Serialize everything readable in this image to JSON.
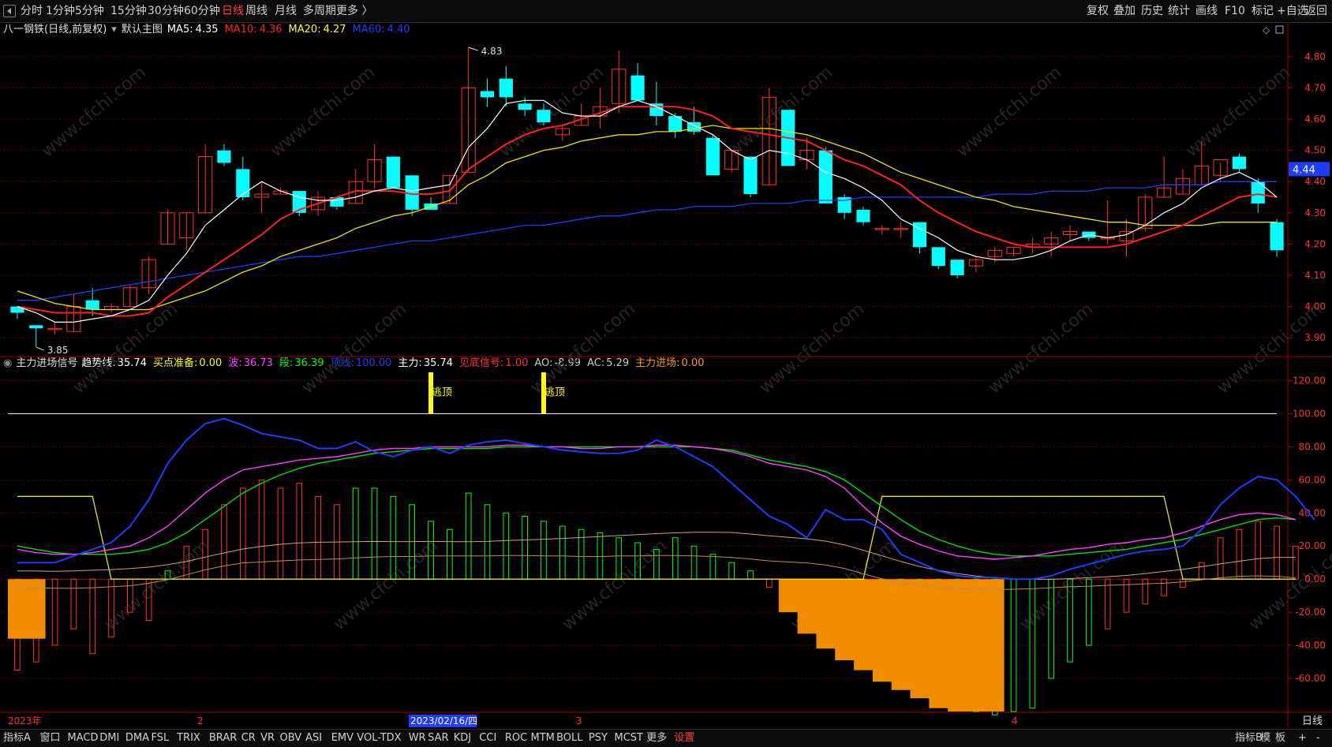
{
  "toolbar": {
    "periods": [
      "分时",
      "1分钟",
      "5分钟",
      "15分钟",
      "30分钟",
      "60分钟",
      "日线",
      "周线",
      "月线",
      "多周期",
      "更多 〉"
    ],
    "active_period": "日线",
    "right_buttons": [
      "复权",
      "叠加",
      "历史",
      "统计",
      "画线",
      "F10",
      "标记",
      "+自选",
      "返回"
    ]
  },
  "main_panel": {
    "stock": "八一钢铁",
    "mode": "(日线,前复权)",
    "template": "默认主图",
    "ma_legend": [
      {
        "label": "MA5:",
        "value": "4.35",
        "color": "#ffffff"
      },
      {
        "label": "MA10:",
        "value": "4.36",
        "color": "#ff2020"
      },
      {
        "label": "MA20:",
        "value": "4.27",
        "color": "#ffff00"
      },
      {
        "label": "MA60:",
        "value": "4.40",
        "color": "#1e3cff"
      }
    ],
    "price_axis": [
      "4.80",
      "4.70",
      "4.60",
      "4.50",
      "4.40",
      "4.30",
      "4.20",
      "4.10",
      "4.00",
      "3.90"
    ],
    "current_price_tag": "4.44",
    "high_label": "4.83",
    "low_label": "3.85"
  },
  "indicator_panel": {
    "name": "主力进场信号",
    "legend": [
      {
        "label": "趋势线:",
        "value": "35.74",
        "color": "#ffffff"
      },
      {
        "label": "买点准备:",
        "value": "0.00",
        "color": "#ffff00"
      },
      {
        "label": "波:",
        "value": "36.73",
        "color": "#ff40ff"
      },
      {
        "label": "段:",
        "value": "36.39",
        "color": "#00ff00"
      },
      {
        "label": "顶线:",
        "value": "100.00",
        "color": "#1e3cff"
      },
      {
        "label": "主力:",
        "value": "35.74",
        "color": "#ffffff"
      },
      {
        "label": "见底信号:",
        "value": "1.00",
        "color": "#ff3030"
      },
      {
        "label": "AO:",
        "value": "-8.99",
        "color": "#c8c8c8"
      },
      {
        "label": "AC:",
        "value": "5.29",
        "color": "#c8c8c8"
      },
      {
        "label": "主力进场:",
        "value": "0.00",
        "color": "#ff9a00"
      }
    ],
    "y_axis": [
      "120.00",
      "100.00",
      "80.00",
      "60.00",
      "40.00",
      "20.00",
      "0.00",
      "-20.00",
      "-40.00",
      "-60.00"
    ],
    "signal_labels": [
      "逃顶",
      "逃顶"
    ]
  },
  "date_axis": {
    "labels": [
      "2023年",
      "2",
      "2023/02/16/四",
      "3",
      "4"
    ],
    "period": "日线"
  },
  "bottom_tabs": [
    "指标A",
    "窗口",
    "MACD",
    "DMI",
    "DMA",
    "FSL",
    "TRIX",
    "BRAR",
    "CR",
    "VR",
    "OBV",
    "ASI",
    "EMV",
    "VOL-TDX",
    "WR",
    "SAR",
    "KDJ",
    "CCI",
    "ROC",
    "MTM",
    "BOLL",
    "PSY",
    "MCST",
    "更多",
    "设置"
  ],
  "bottom_right": [
    "指标B",
    "模",
    "板",
    "+",
    "-"
  ],
  "colors": {
    "up": "#ff3030",
    "down": "#00ffff",
    "grid": "#5a0000",
    "watermark": "#2a2a2a"
  },
  "chart_data": {
    "type": "candlestick",
    "title": "八一钢铁 (日线,前复权)",
    "ylim": [
      3.86,
      4.83
    ],
    "ohlc": [
      [
        4.0,
        4.0,
        3.96,
        3.98
      ],
      [
        3.94,
        3.94,
        3.87,
        3.93
      ],
      [
        3.93,
        3.95,
        3.91,
        3.93
      ],
      [
        3.92,
        4.04,
        3.92,
        4.0
      ],
      [
        4.02,
        4.06,
        3.97,
        3.99
      ],
      [
        3.99,
        4.01,
        3.98,
        4.0
      ],
      [
        4.0,
        4.07,
        4.0,
        4.06
      ],
      [
        4.06,
        4.16,
        4.04,
        4.15
      ],
      [
        4.2,
        4.31,
        4.2,
        4.3
      ],
      [
        4.22,
        4.3,
        4.18,
        4.3
      ],
      [
        4.3,
        4.52,
        4.3,
        4.48
      ],
      [
        4.5,
        4.52,
        4.45,
        4.46
      ],
      [
        4.44,
        4.48,
        4.34,
        4.35
      ],
      [
        4.35,
        4.4,
        4.3,
        4.36
      ],
      [
        4.36,
        4.38,
        4.36,
        4.37
      ],
      [
        4.37,
        4.37,
        4.29,
        4.3
      ],
      [
        4.31,
        4.37,
        4.29,
        4.35
      ],
      [
        4.35,
        4.35,
        4.31,
        4.32
      ],
      [
        4.33,
        4.44,
        4.33,
        4.4
      ],
      [
        4.4,
        4.52,
        4.38,
        4.47
      ],
      [
        4.48,
        4.48,
        4.38,
        4.38
      ],
      [
        4.42,
        4.42,
        4.29,
        4.31
      ],
      [
        4.33,
        4.35,
        4.31,
        4.31
      ],
      [
        4.33,
        4.42,
        4.33,
        4.42
      ],
      [
        4.43,
        4.83,
        4.43,
        4.7
      ],
      [
        4.69,
        4.73,
        4.64,
        4.67
      ],
      [
        4.73,
        4.77,
        4.64,
        4.67
      ],
      [
        4.65,
        4.67,
        4.61,
        4.63
      ],
      [
        4.63,
        4.65,
        4.58,
        4.59
      ],
      [
        4.55,
        4.58,
        4.53,
        4.57
      ],
      [
        4.58,
        4.65,
        4.58,
        4.61
      ],
      [
        4.61,
        4.7,
        4.57,
        4.64
      ],
      [
        4.65,
        4.82,
        4.62,
        4.76
      ],
      [
        4.74,
        4.78,
        4.66,
        4.66
      ],
      [
        4.65,
        4.72,
        4.58,
        4.61
      ],
      [
        4.61,
        4.62,
        4.54,
        4.56
      ],
      [
        4.59,
        4.64,
        4.55,
        4.56
      ],
      [
        4.54,
        4.55,
        4.46,
        4.42
      ],
      [
        4.44,
        4.5,
        4.43,
        4.5
      ],
      [
        4.48,
        4.48,
        4.35,
        4.36
      ],
      [
        4.39,
        4.7,
        4.39,
        4.67
      ],
      [
        4.63,
        4.63,
        4.45,
        4.45
      ],
      [
        4.47,
        4.54,
        4.44,
        4.5
      ],
      [
        4.5,
        4.51,
        4.33,
        4.33
      ],
      [
        4.35,
        4.36,
        4.28,
        4.3
      ],
      [
        4.31,
        4.32,
        4.26,
        4.27
      ],
      [
        4.25,
        4.26,
        4.23,
        4.25
      ],
      [
        4.25,
        4.27,
        4.22,
        4.25
      ],
      [
        4.27,
        4.27,
        4.17,
        4.19
      ],
      [
        4.19,
        4.19,
        4.12,
        4.13
      ],
      [
        4.15,
        4.15,
        4.09,
        4.1
      ],
      [
        4.13,
        4.16,
        4.11,
        4.15
      ],
      [
        4.16,
        4.19,
        4.14,
        4.18
      ],
      [
        4.17,
        4.19,
        4.16,
        4.19
      ],
      [
        4.19,
        4.22,
        4.17,
        4.2
      ],
      [
        4.2,
        4.24,
        4.16,
        4.22
      ],
      [
        4.23,
        4.26,
        4.21,
        4.24
      ],
      [
        4.24,
        4.24,
        4.21,
        4.22
      ],
      [
        4.22,
        4.34,
        4.2,
        4.22
      ],
      [
        4.21,
        4.28,
        4.16,
        4.24
      ],
      [
        4.25,
        4.36,
        4.24,
        4.35
      ],
      [
        4.35,
        4.48,
        4.35,
        4.38
      ],
      [
        4.36,
        4.44,
        4.36,
        4.41
      ],
      [
        4.39,
        4.53,
        4.39,
        4.45
      ],
      [
        4.42,
        4.46,
        4.4,
        4.47
      ],
      [
        4.48,
        4.49,
        4.43,
        4.44
      ],
      [
        4.4,
        4.41,
        4.3,
        4.33
      ],
      [
        4.27,
        4.28,
        4.16,
        4.18
      ]
    ],
    "ma5": [
      4.0,
      3.98,
      3.95,
      3.95,
      3.96,
      3.97,
      3.99,
      4.02,
      4.1,
      4.17,
      4.26,
      4.31,
      4.36,
      4.4,
      4.37,
      4.35,
      4.34,
      4.34,
      4.35,
      4.37,
      4.38,
      4.37,
      4.38,
      4.39,
      4.51,
      4.57,
      4.65,
      4.66,
      4.66,
      4.62,
      4.61,
      4.61,
      4.64,
      4.66,
      4.64,
      4.61,
      4.58,
      4.55,
      4.5,
      4.47,
      4.5,
      4.49,
      4.47,
      4.43,
      4.41,
      4.38,
      4.34,
      4.28,
      4.25,
      4.22,
      4.18,
      4.16,
      4.15,
      4.15,
      4.16,
      4.18,
      4.21,
      4.23,
      4.22,
      4.23,
      4.26,
      4.3,
      4.33,
      4.38,
      4.41,
      4.43,
      4.4,
      4.35
    ],
    "ma10": [
      4.0,
      3.99,
      3.98,
      3.98,
      3.98,
      3.97,
      3.97,
      3.98,
      4.03,
      4.07,
      4.11,
      4.15,
      4.19,
      4.23,
      4.28,
      4.31,
      4.33,
      4.35,
      4.37,
      4.37,
      4.37,
      4.36,
      4.36,
      4.37,
      4.44,
      4.48,
      4.52,
      4.55,
      4.57,
      4.58,
      4.6,
      4.62,
      4.64,
      4.64,
      4.64,
      4.64,
      4.63,
      4.61,
      4.57,
      4.56,
      4.55,
      4.54,
      4.53,
      4.5,
      4.47,
      4.45,
      4.42,
      4.39,
      4.34,
      4.3,
      4.27,
      4.24,
      4.22,
      4.2,
      4.19,
      4.19,
      4.19,
      4.19,
      4.19,
      4.2,
      4.22,
      4.24,
      4.26,
      4.29,
      4.32,
      4.35,
      4.36,
      4.35
    ],
    "ma20": [
      4.05,
      4.03,
      4.01,
      4.0,
      3.99,
      3.99,
      3.99,
      3.99,
      4.01,
      4.03,
      4.05,
      4.08,
      4.11,
      4.13,
      4.16,
      4.18,
      4.2,
      4.22,
      4.25,
      4.27,
      4.29,
      4.3,
      4.32,
      4.34,
      4.39,
      4.42,
      4.46,
      4.48,
      4.5,
      4.51,
      4.53,
      4.54,
      4.55,
      4.55,
      4.56,
      4.56,
      4.57,
      4.58,
      4.57,
      4.57,
      4.57,
      4.56,
      4.55,
      4.53,
      4.51,
      4.49,
      4.46,
      4.43,
      4.41,
      4.39,
      4.37,
      4.35,
      4.34,
      4.32,
      4.31,
      4.3,
      4.29,
      4.28,
      4.27,
      4.27,
      4.26,
      4.26,
      4.26,
      4.26,
      4.27,
      4.27,
      4.27,
      4.27
    ],
    "ma60": [
      4.02,
      4.02,
      4.03,
      4.04,
      4.05,
      4.06,
      4.07,
      4.08,
      4.09,
      4.1,
      4.11,
      4.12,
      4.13,
      4.14,
      4.15,
      4.16,
      4.16,
      4.17,
      4.18,
      4.19,
      4.2,
      4.21,
      4.21,
      4.22,
      4.23,
      4.24,
      4.25,
      4.26,
      4.26,
      4.27,
      4.28,
      4.29,
      4.29,
      4.3,
      4.31,
      4.31,
      4.32,
      4.32,
      4.32,
      4.33,
      4.33,
      4.33,
      4.34,
      4.34,
      4.34,
      4.35,
      4.35,
      4.35,
      4.35,
      4.35,
      4.35,
      4.35,
      4.36,
      4.36,
      4.36,
      4.37,
      4.37,
      4.37,
      4.38,
      4.38,
      4.38,
      4.39,
      4.39,
      4.39,
      4.4,
      4.4,
      4.4,
      4.4
    ],
    "indicator": {
      "ylim": [
        -80,
        125
      ],
      "top_line": 100,
      "blue": [
        10,
        10,
        10,
        14,
        18,
        22,
        32,
        48,
        70,
        84,
        94,
        97,
        93,
        88,
        86,
        84,
        79,
        79,
        83,
        77,
        74,
        78,
        80,
        76,
        81,
        83,
        84,
        82,
        80,
        78,
        77,
        76,
        76,
        78,
        84,
        80,
        74,
        68,
        58,
        48,
        38,
        33,
        25,
        42,
        36,
        36,
        30,
        15,
        10,
        5,
        2,
        1,
        1,
        0,
        0,
        2,
        6,
        9,
        12,
        15,
        17,
        18,
        20,
        30,
        45,
        55,
        62,
        60,
        50,
        36
      ],
      "magenta": [
        18,
        16,
        15,
        15,
        16,
        18,
        20,
        25,
        32,
        42,
        52,
        60,
        66,
        68,
        70,
        72,
        73,
        74,
        76,
        78,
        79,
        79,
        80,
        80,
        80,
        80,
        81,
        81,
        80,
        80,
        79,
        79,
        80,
        80,
        81,
        81,
        80,
        79,
        77,
        74,
        70,
        68,
        66,
        62,
        55,
        44,
        34,
        26,
        21,
        17,
        14,
        13,
        12,
        13,
        14,
        16,
        18,
        19,
        21,
        22,
        24,
        25,
        28,
        32,
        36,
        39,
        40,
        39,
        36
      ],
      "green": [
        20,
        18,
        16,
        15,
        15,
        15,
        16,
        18,
        22,
        28,
        36,
        44,
        52,
        58,
        63,
        67,
        70,
        72,
        74,
        76,
        77,
        78,
        79,
        79,
        79,
        79,
        80,
        80,
        80,
        80,
        80,
        80,
        80,
        80,
        80,
        80,
        80,
        79,
        78,
        75,
        72,
        70,
        68,
        65,
        60,
        52,
        44,
        36,
        29,
        24,
        20,
        17,
        15,
        14,
        14,
        14,
        15,
        16,
        17,
        18,
        20,
        22,
        24,
        27,
        30,
        33,
        36,
        37,
        36
      ],
      "yellow": [
        50,
        50,
        50,
        50,
        50,
        0,
        0,
        0,
        0,
        0,
        0,
        0,
        0,
        0,
        0,
        0,
        0,
        0,
        0,
        0,
        0,
        0,
        0,
        0,
        0,
        0,
        0,
        0,
        0,
        0,
        0,
        0,
        0,
        0,
        0,
        0,
        0,
        0,
        0,
        0,
        0,
        0,
        0,
        0,
        0,
        0,
        50,
        50,
        50,
        50,
        50,
        50,
        50,
        50,
        50,
        50,
        50,
        50,
        50,
        50,
        50,
        50,
        0,
        0,
        0,
        0,
        0,
        0,
        0
      ],
      "bars": [
        -55,
        -50,
        -40,
        -30,
        -45,
        -35,
        -20,
        -25,
        5,
        20,
        30,
        45,
        55,
        60,
        55,
        58,
        50,
        45,
        55,
        55,
        50,
        45,
        35,
        30,
        52,
        45,
        40,
        38,
        35,
        32,
        30,
        28,
        25,
        22,
        18,
        25,
        20,
        15,
        10,
        5,
        -5,
        -10,
        -20,
        -30,
        -45,
        -50,
        -55,
        -60,
        -65,
        -70,
        -75,
        -80,
        -82,
        -80,
        -78,
        -60,
        -50,
        -40,
        -30,
        -20,
        -15,
        -10,
        -5,
        10,
        25,
        30,
        35,
        32,
        20
      ],
      "signal_x": [
        22,
        28
      ]
    }
  }
}
